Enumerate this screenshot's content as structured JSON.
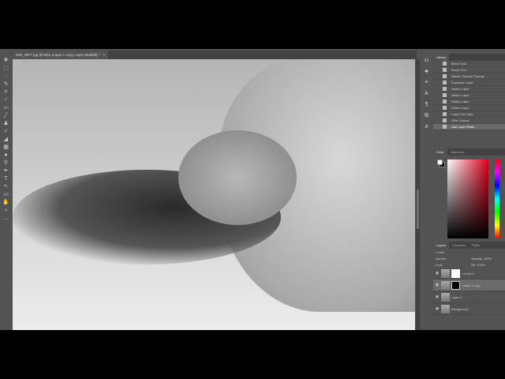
{
  "document_tab": {
    "title": "IMG_0977.jpg @ 50% (Layer 1 copy, Layer Mask/8) *",
    "close": "×"
  },
  "tools": [
    "move-icon",
    "marquee-icon",
    "lasso-icon",
    "quick-select-icon",
    "crop-icon",
    "eyedropper-icon",
    "healing-icon",
    "brush-icon",
    "stamp-icon",
    "history-brush-icon",
    "eraser-icon",
    "gradient-icon",
    "blur-icon",
    "dodge-icon",
    "pen-icon",
    "type-icon",
    "path-select-icon",
    "rectangle-icon",
    "hand-icon",
    "zoom-icon",
    "more-icon"
  ],
  "history": {
    "tab": "History",
    "items": [
      "Brush Tool",
      "Brush Tool",
      "Master Opacity Change",
      "Duplicate Layer",
      "Delete Layer",
      "Delete Layer",
      "Delete Layer",
      "Delete Layer",
      "Layer Via Copy",
      "Filter Gallery",
      "Add Layer Mask"
    ],
    "selected": 10
  },
  "color": {
    "tabs": [
      "Color",
      "Swatches"
    ],
    "foreground": "#ffffff",
    "background": "#000000",
    "hue": "#e0001c"
  },
  "layers_panel": {
    "tabs": [
      "Layers",
      "Channels",
      "Paths"
    ],
    "filter": "Kind",
    "blend_mode": "Normal",
    "opacity_label": "Opacity:",
    "opacity": "100%",
    "lock_label": "Lock:",
    "fill_label": "Fill:",
    "fill": "100%",
    "layers": [
      {
        "name": "Levels 1"
      },
      {
        "name": "Layer 1 copy"
      },
      {
        "name": "Layer 1"
      },
      {
        "name": "Background"
      }
    ],
    "selected": 1
  }
}
